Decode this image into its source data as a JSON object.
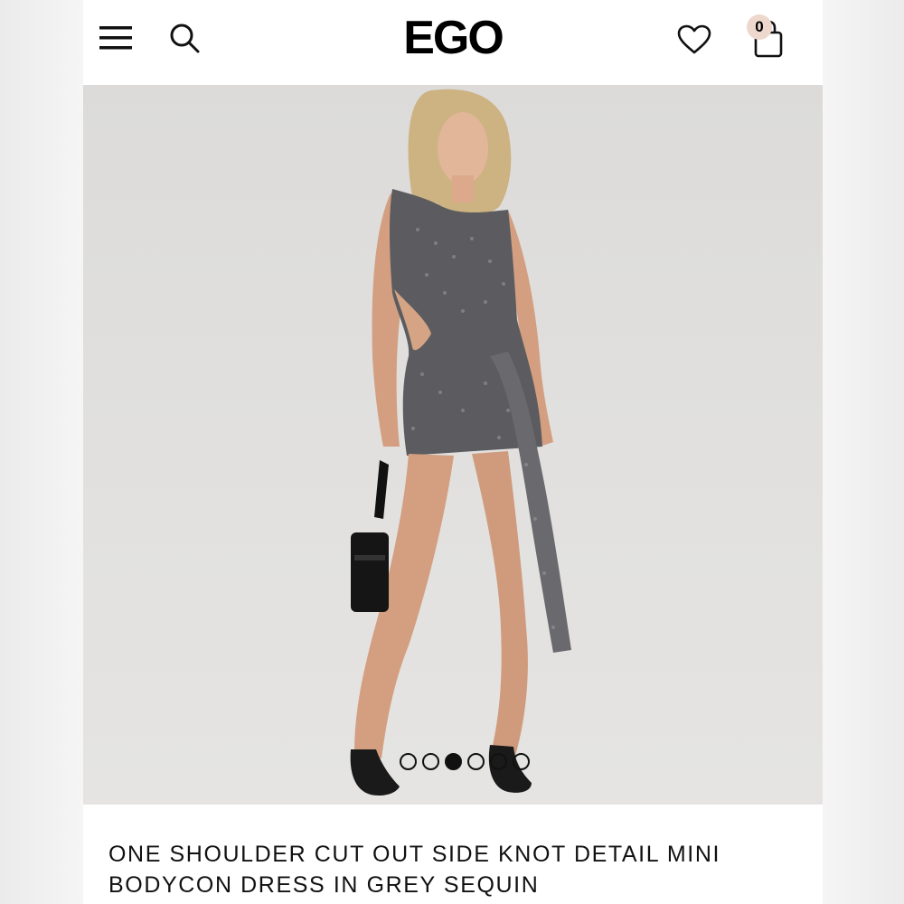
{
  "brand": {
    "logo_text": "EGO"
  },
  "header": {
    "menu_icon": "hamburger-menu-icon",
    "search_icon": "search-icon",
    "wishlist_icon": "heart-icon",
    "bag_icon": "shopping-bag-icon",
    "bag_count": "0"
  },
  "gallery": {
    "image_count": 6,
    "active_index": 3
  },
  "product": {
    "title": "ONE SHOULDER CUT OUT SIDE KNOT DETAIL MINI BODYCON DRESS IN GREY SEQUIN"
  },
  "colors": {
    "accent_badge": "#eed8cd",
    "text": "#111111",
    "background": "#ffffff"
  }
}
